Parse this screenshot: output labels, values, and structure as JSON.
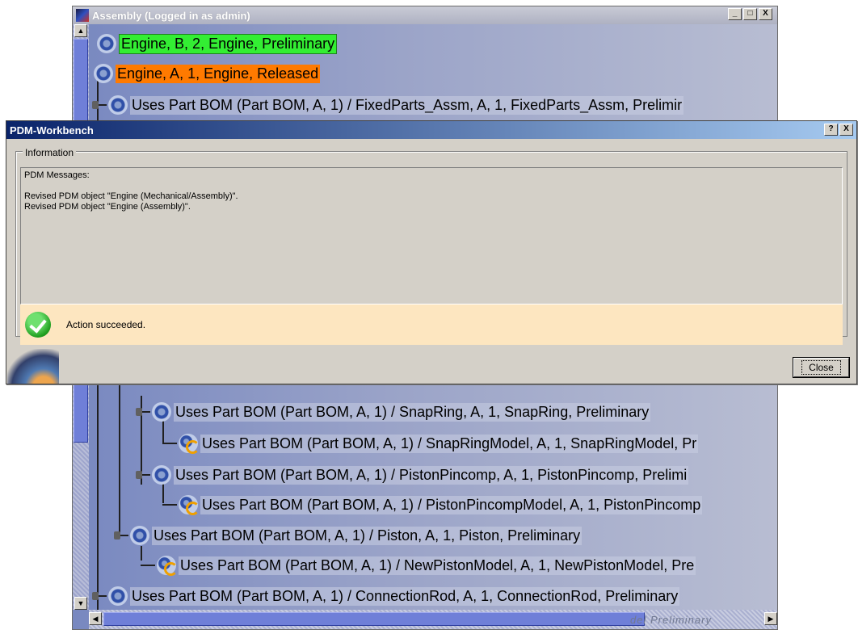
{
  "assembly_window": {
    "title": "Assembly (Logged in as admin)",
    "controls": {
      "minimize": "_",
      "maximize": "□",
      "close": "X"
    },
    "tree_rows": [
      {
        "label": "Engine, B, 2, Engine, Preliminary",
        "style": "green",
        "icon": "engine-icon"
      },
      {
        "label": "Engine, A, 1, Engine, Released",
        "style": "orange",
        "icon": "engine-icon"
      },
      {
        "label": "Uses Part BOM (Part BOM, A, 1) / FixedParts_Assm, A, 1, FixedParts_Assm, Prelimir",
        "icon": "part-icon"
      },
      {
        "label": "Uses Part BOM (Part BOM, A, 1) / SnapRing, A, 1, SnapRing, Preliminary",
        "icon": "part-icon"
      },
      {
        "label": "Uses Part BOM (Part BOM, A, 1) / SnapRingModel, A, 1, SnapRingModel, Pr",
        "icon": "model-icon"
      },
      {
        "label": "Uses Part BOM (Part BOM, A, 1) / PistonPincomp, A, 1, PistonPincomp, Prelimi",
        "icon": "part-icon"
      },
      {
        "label": "Uses Part BOM (Part BOM, A, 1) / PistonPincompModel, A, 1, PistonPincomp",
        "icon": "model-icon"
      },
      {
        "label": "Uses Part BOM (Part BOM, A, 1) / Piston, A, 1, Piston, Preliminary",
        "icon": "part-icon"
      },
      {
        "label": "Uses Part BOM (Part BOM, A, 1) / NewPistonModel, A, 1, NewPistonModel, Pre",
        "icon": "model-icon"
      },
      {
        "label": "Uses Part BOM (Part BOM, A, 1) / ConnectionRod, A, 1, ConnectionRod, Preliminary",
        "icon": "part-icon"
      }
    ],
    "hscroll_ghost_text": "del  Preliminary"
  },
  "dialog": {
    "title": "PDM-Workbench",
    "controls": {
      "help": "?",
      "close": "X"
    },
    "group_label": "Information",
    "messages": [
      "PDM Messages:",
      "",
      "Revised PDM object \"Engine (Mechanical/Assembly)\".",
      "Revised PDM object \"Engine (Assembly)\"."
    ],
    "status_text": "Action succeeded.",
    "close_label": "Close"
  },
  "colors": {
    "dialog_title_start": "#0a246a",
    "dialog_title_end": "#a6caf0",
    "status_background": "#fde6c0",
    "highlight_green": "#33ee33",
    "highlight_orange": "#ff7a00"
  }
}
